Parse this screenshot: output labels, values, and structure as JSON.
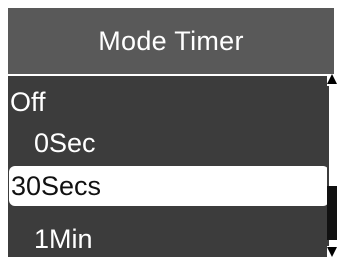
{
  "header": {
    "title": "Mode Timer"
  },
  "menu": {
    "items": [
      {
        "label": "Off",
        "selected": false
      },
      {
        "label": "0Sec",
        "selected": false
      },
      {
        "label": "30Secs",
        "selected": true
      },
      {
        "label": "1Min",
        "selected": false
      }
    ]
  },
  "colors": {
    "title_bar": "#595959",
    "list_background": "#3c3c3c",
    "highlight": "#ffffff",
    "text_light": "#ffffff",
    "text_dark": "#111111"
  },
  "icons": {
    "scroll_up": "scroll-up-arrow-icon",
    "scroll_down": "scroll-down-arrow-icon"
  }
}
